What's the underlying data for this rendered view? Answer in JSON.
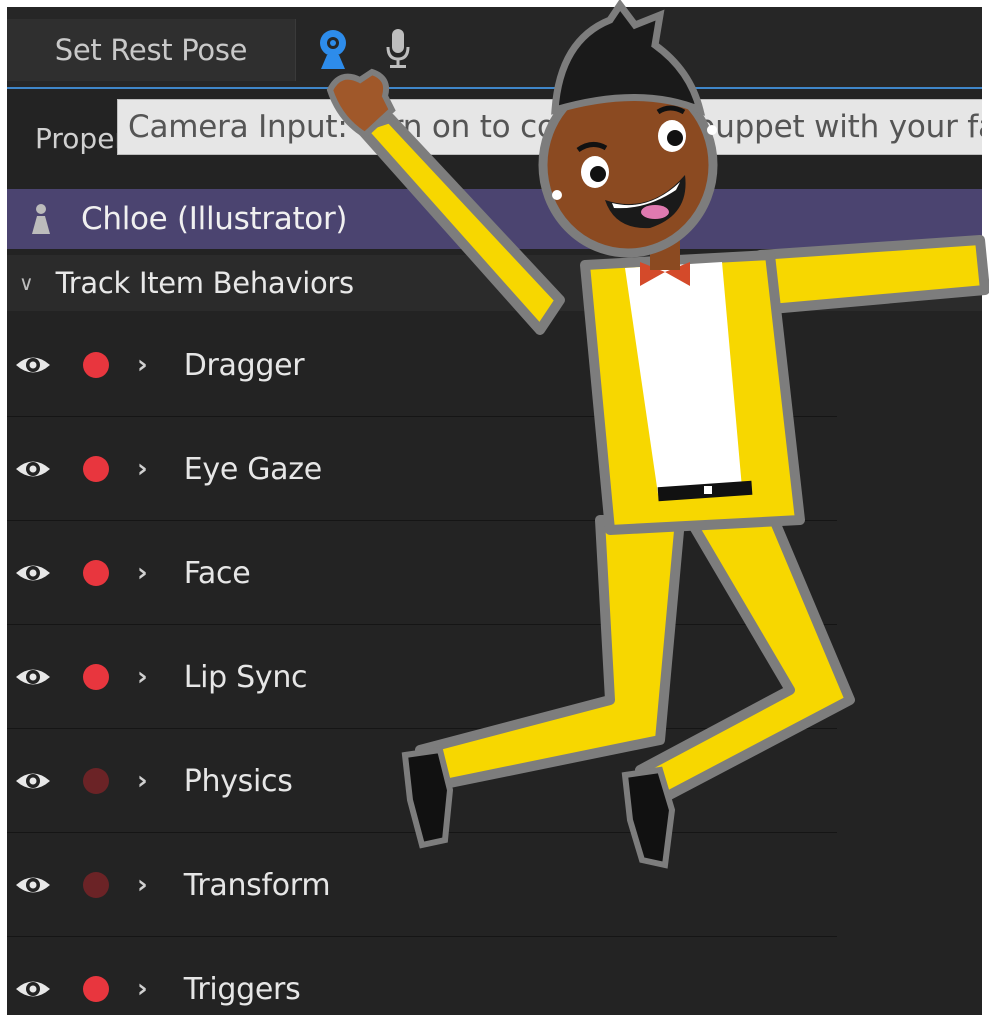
{
  "toolbar": {
    "rest_pose_label": "Set Rest Pose",
    "camera_icon": "webcam-icon",
    "mic_icon": "microphone-icon",
    "accent_color": "#3f86c9"
  },
  "tooltip": {
    "text": "Camera Input: Turn on to control the puppet with your face"
  },
  "properties": {
    "label": "Properties"
  },
  "puppet": {
    "name": "Chloe (Illustrator)",
    "row_color": "#4b4470"
  },
  "section": {
    "title": "Track Item Behaviors"
  },
  "behaviors": [
    {
      "label": "Dragger",
      "armed": true
    },
    {
      "label": "Eye Gaze",
      "armed": true
    },
    {
      "label": "Face",
      "armed": true
    },
    {
      "label": "Lip Sync",
      "armed": true
    },
    {
      "label": "Physics",
      "armed": false
    },
    {
      "label": "Transform",
      "armed": false
    },
    {
      "label": "Triggers",
      "armed": true
    }
  ],
  "colors": {
    "armed": "#e8363e",
    "disarmed": "#6b2326"
  }
}
